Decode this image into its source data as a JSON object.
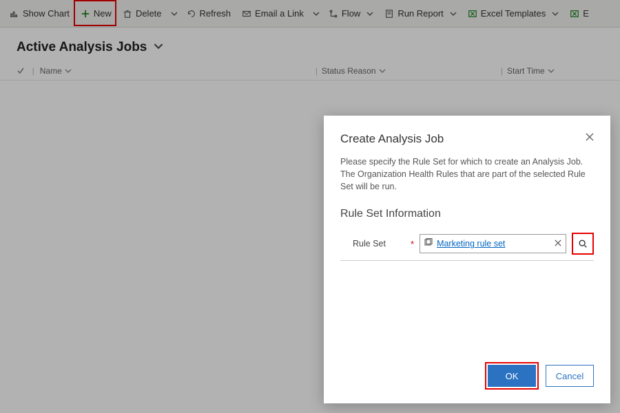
{
  "toolbar": {
    "show_chart": "Show Chart",
    "new": "New",
    "delete": "Delete",
    "refresh": "Refresh",
    "email_link": "Email a Link",
    "flow": "Flow",
    "run_report": "Run Report",
    "excel_templates": "Excel Templates",
    "excel_tail": "E"
  },
  "page": {
    "title": "Active Analysis Jobs"
  },
  "columns": {
    "name": "Name",
    "status": "Status Reason",
    "start": "Start Time"
  },
  "dialog": {
    "title": "Create Analysis Job",
    "desc": "Please specify the Rule Set for which to create an Analysis Job. The Organization Health Rules that are part of the selected Rule Set will be run.",
    "section": "Rule Set Information",
    "field_label": "Rule Set",
    "lookup_value": "Marketing rule set",
    "ok": "OK",
    "cancel": "Cancel"
  }
}
